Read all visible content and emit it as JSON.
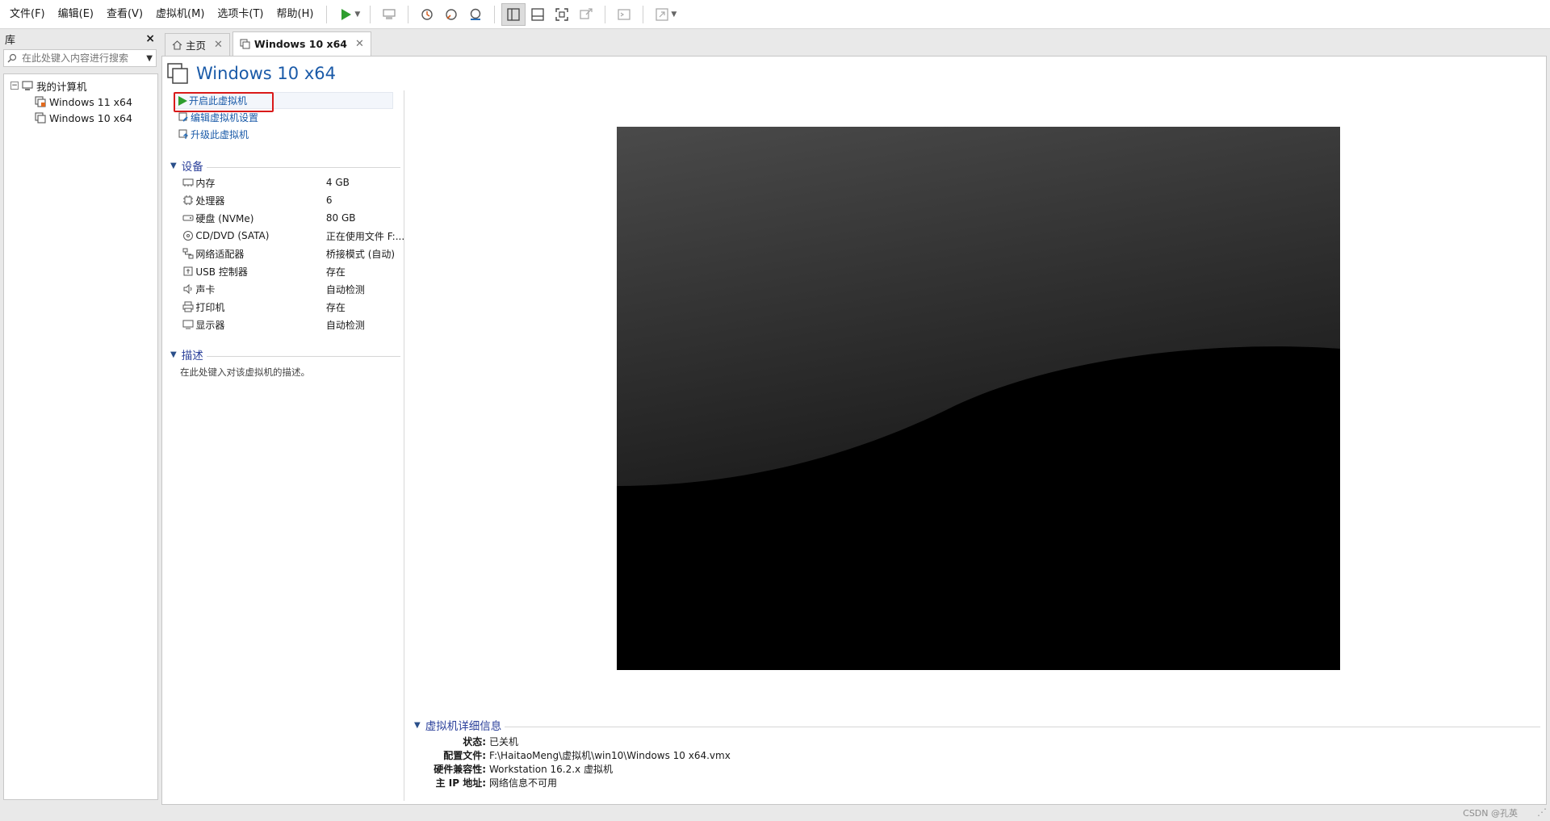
{
  "menu": [
    "文件(F)",
    "编辑(E)",
    "查看(V)",
    "虚拟机(M)",
    "选项卡(T)",
    "帮助(H)"
  ],
  "toolbar": {
    "icons": [
      "play-icon",
      "send-keys-icon",
      "snapshot-icon",
      "revert-snapshot-icon",
      "snapshot-manager-icon",
      "show-library-icon",
      "thumbnail-bar-icon",
      "fullscreen-icon",
      "unity-icon",
      "console-view-icon",
      "stretch-icon"
    ]
  },
  "library": {
    "title": "库",
    "close": "×",
    "search_placeholder": "在此处键入内容进行搜索",
    "tree": {
      "root": "我的计算机",
      "items": [
        "Windows 11 x64",
        "Windows 10 x64"
      ]
    }
  },
  "tabs": [
    {
      "label": "主页"
    },
    {
      "label": "Windows 10 x64"
    }
  ],
  "vm": {
    "title": "Windows 10 x64",
    "actions": [
      "开启此虚拟机",
      "编辑虚拟机设置",
      "升级此虚拟机"
    ],
    "devices_title": "设备",
    "devices": [
      {
        "icon": "memory-icon",
        "name": "内存",
        "value": "4 GB"
      },
      {
        "icon": "processor-icon",
        "name": "处理器",
        "value": "6"
      },
      {
        "icon": "hard-disk-icon",
        "name": "硬盘 (NVMe)",
        "value": "80 GB"
      },
      {
        "icon": "cd-dvd-icon",
        "name": "CD/DVD (SATA)",
        "value": "正在使用文件 F:..."
      },
      {
        "icon": "network-adapter-icon",
        "name": "网络适配器",
        "value": "桥接模式 (自动)"
      },
      {
        "icon": "usb-icon",
        "name": "USB 控制器",
        "value": "存在"
      },
      {
        "icon": "sound-card-icon",
        "name": "声卡",
        "value": "自动检测"
      },
      {
        "icon": "printer-icon",
        "name": "打印机",
        "value": "存在"
      },
      {
        "icon": "display-icon",
        "name": "显示器",
        "value": "自动检测"
      }
    ],
    "description_title": "描述",
    "description_placeholder": "在此处键入对该虚拟机的描述。",
    "details_title": "虚拟机详细信息",
    "details": [
      {
        "key": "状态:",
        "value": "已关机"
      },
      {
        "key": "配置文件:",
        "value": "F:\\HaitaoMeng\\虚拟机\\win10\\Windows 10 x64.vmx"
      },
      {
        "key": "硬件兼容性:",
        "value": "Workstation 16.2.x 虚拟机"
      },
      {
        "key": "主 IP 地址:",
        "value": "网络信息不可用"
      }
    ]
  },
  "watermark": "CSDN @孔英",
  "colors": {
    "accent": "#1a5aa8",
    "section": "#2a3f9a",
    "highlight": "#d91a1a",
    "play": "#2e9e2e"
  }
}
